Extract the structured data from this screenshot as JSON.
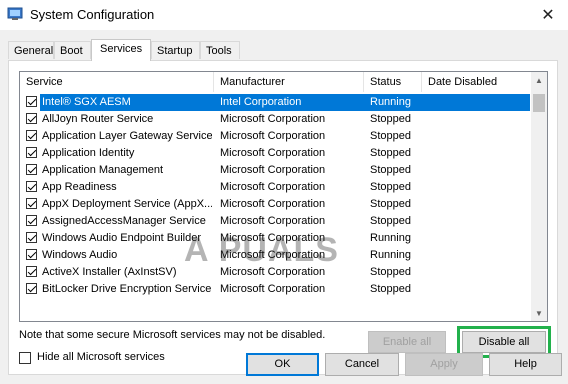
{
  "window": {
    "title": "System Configuration",
    "close_glyph": "✕"
  },
  "tabs": [
    {
      "label": "General"
    },
    {
      "label": "Boot"
    },
    {
      "label": "Services",
      "active": true
    },
    {
      "label": "Startup"
    },
    {
      "label": "Tools"
    }
  ],
  "columns": [
    "Service",
    "Manufacturer",
    "Status",
    "Date Disabled"
  ],
  "services": [
    {
      "name": "Intel® SGX AESM",
      "manufacturer": "Intel Corporation",
      "status": "Running",
      "checked": true,
      "selected": true
    },
    {
      "name": "AllJoyn Router Service",
      "manufacturer": "Microsoft Corporation",
      "status": "Stopped",
      "checked": true
    },
    {
      "name": "Application Layer Gateway Service",
      "manufacturer": "Microsoft Corporation",
      "status": "Stopped",
      "checked": true
    },
    {
      "name": "Application Identity",
      "manufacturer": "Microsoft Corporation",
      "status": "Stopped",
      "checked": true
    },
    {
      "name": "Application Management",
      "manufacturer": "Microsoft Corporation",
      "status": "Stopped",
      "checked": true
    },
    {
      "name": "App Readiness",
      "manufacturer": "Microsoft Corporation",
      "status": "Stopped",
      "checked": true
    },
    {
      "name": "AppX Deployment Service (AppX...",
      "manufacturer": "Microsoft Corporation",
      "status": "Stopped",
      "checked": true
    },
    {
      "name": "AssignedAccessManager Service",
      "manufacturer": "Microsoft Corporation",
      "status": "Stopped",
      "checked": true
    },
    {
      "name": "Windows Audio Endpoint Builder",
      "manufacturer": "Microsoft Corporation",
      "status": "Running",
      "checked": true
    },
    {
      "name": "Windows Audio",
      "manufacturer": "Microsoft Corporation",
      "status": "Running",
      "checked": true
    },
    {
      "name": "ActiveX Installer (AxInstSV)",
      "manufacturer": "Microsoft Corporation",
      "status": "Stopped",
      "checked": true
    },
    {
      "name": "BitLocker Drive Encryption Service",
      "manufacturer": "Microsoft Corporation",
      "status": "Stopped",
      "checked": true
    }
  ],
  "note": "Note that some secure Microsoft services may not be disabled.",
  "enable_all": "Enable all",
  "disable_all": "Disable all",
  "hide_ms_label": "Hide all Microsoft services",
  "buttons": {
    "ok": "OK",
    "cancel": "Cancel",
    "apply": "Apply",
    "help": "Help"
  },
  "watermark": "A  PUALS",
  "colors": {
    "selection": "#0078d7",
    "highlight": "#22b14c"
  }
}
